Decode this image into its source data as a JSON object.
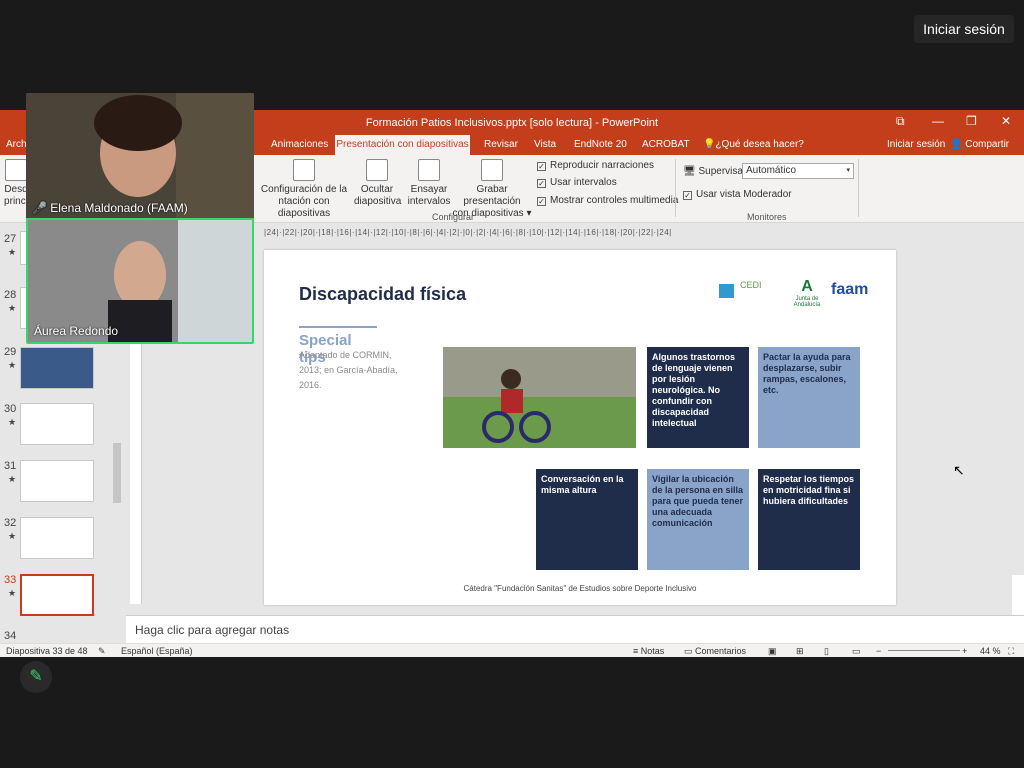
{
  "meeting": {
    "signin_label": "Iniciar sesión"
  },
  "window": {
    "title": "Formación Patios Inclusivos.pptx [solo lectura] - PowerPoint",
    "minimize_glyph": "—",
    "restore_glyph": "❐",
    "close_glyph": "✕",
    "ribbon_icon_glyph": "⧉"
  },
  "tabs": {
    "file": "Arch",
    "items": [
      "Animaciones",
      "Presentación con diapositivas",
      "Revisar",
      "Vista",
      "EndNote 20",
      "ACROBAT"
    ],
    "active": "Presentación con diapositivas",
    "tell_me": "¿Qué desea hacer?",
    "signin": "Iniciar sesión",
    "share": "Compartir"
  },
  "ribbon": {
    "desde": [
      "Desd",
      "princi"
    ],
    "config": [
      "Configuración de la",
      "ntación con diapositivas"
    ],
    "ocultar": [
      "Ocultar",
      "diapositiva"
    ],
    "ensayar": [
      "Ensayar",
      "intervalos"
    ],
    "grabar": [
      "Grabar presentación",
      "con diapositivas ▾"
    ],
    "check_narraciones": "Reproducir narraciones",
    "check_intervalos": "Usar intervalos",
    "check_controles": "Mostrar controles multimedia",
    "group_configurar": "Configurar",
    "supervisar_label": "Supervisar:",
    "supervisar_value": "Automático",
    "check_moderador": "Usar vista Moderador",
    "group_monitores": "Monitores"
  },
  "thumbnails": [
    {
      "num": "27",
      "star": "★"
    },
    {
      "num": "28",
      "star": "★"
    },
    {
      "num": "29",
      "star": "★"
    },
    {
      "num": "30",
      "star": "★"
    },
    {
      "num": "31",
      "star": "★"
    },
    {
      "num": "32",
      "star": "★"
    },
    {
      "num": "33",
      "star": "★"
    },
    {
      "num": "34",
      "star": ""
    }
  ],
  "ruler_top": "|24|·|22|·|20|·|18|·|16|·|14|·|12|·|10|·|8|·|6|·|4|·|2|·|0|·|2|·|4|·|6|·|8|·|10|·|12|·|14|·|16|·|18|·|20|·|22|·|24|",
  "slide": {
    "title": "Discapacidad física",
    "subtitle": "Special tips",
    "source": "Adaptado de CORMIN, 2013; en García-Abadía, 2016.",
    "logos": {
      "cedi": "CEDI",
      "junta": "Junta de Andalucía",
      "faam": "faam"
    },
    "cards": [
      "Algunos trastornos de lenguaje vienen por lesión neurológica. No confundir con discapacidad intelectual",
      "Pactar la ayuda para desplazarse, subir rampas, escalones, etc.",
      "Conversación en la misma altura",
      "Vigilar la ubicación de la persona en silla para que pueda tener una adecuada comunicación",
      "Respetar los tiempos en motricidad fina si hubiera dificultades"
    ],
    "footer": "Cátedra \"Fundación Sanitas\" de Estudios sobre Deporte Inclusivo"
  },
  "notes_placeholder": "Haga clic para agregar notas",
  "status": {
    "slide_counter": "Diapositiva 33 de 48",
    "language": "Español (España)",
    "notes": "Notas",
    "comments": "Comentarios",
    "zoom": "44 %"
  },
  "participants": [
    {
      "name": "Elena Maldonado (FAAM)"
    },
    {
      "name": "Áurea Redondo"
    }
  ]
}
